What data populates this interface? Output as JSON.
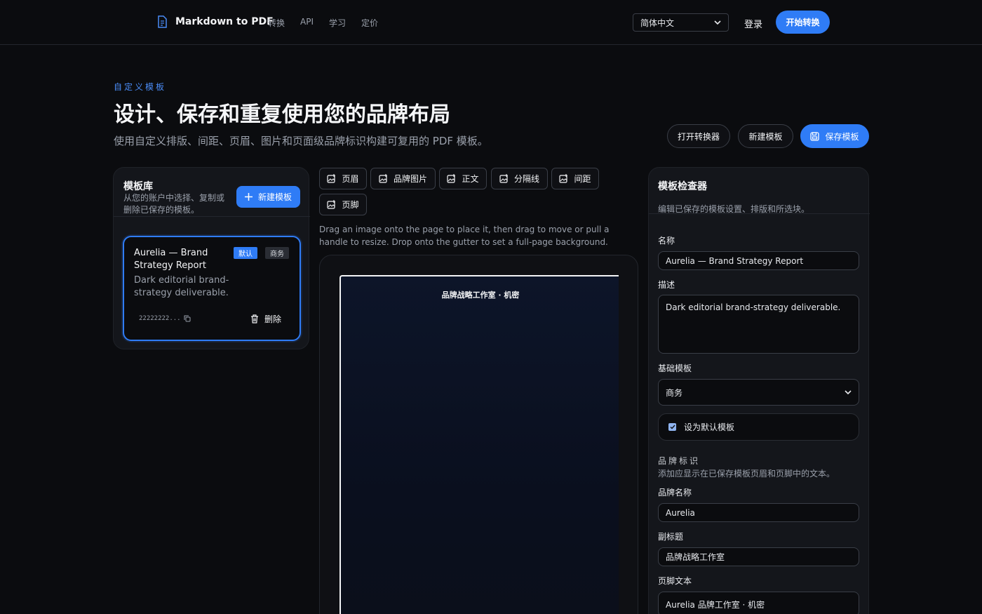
{
  "nav": {
    "brand": "Markdown to PDF",
    "links": [
      "转换",
      "API",
      "学习",
      "定价"
    ],
    "language": "简体中文",
    "login": "登录",
    "start": "开始转换"
  },
  "hero": {
    "eyebrow": "自定义模板",
    "title": "设计、保存和重复使用您的品牌布局",
    "subtitle": "使用自定义排版、间距、页眉、图片和页面级品牌标识构建可复用的 PDF 模板。",
    "open_converter": "打开转换器",
    "new_template": "新建模板",
    "save_template": "保存模板"
  },
  "library": {
    "title": "模板库",
    "description": "从您的账户中选择、复制或删除已保存的模板。",
    "new_button": "新建模板",
    "card": {
      "name": "Aurelia — Brand Strategy Report",
      "badge_default": "默认",
      "badge_type": "商务",
      "description": "Dark editorial brand-strategy deliverable.",
      "id": "22222222...",
      "delete": "删除"
    }
  },
  "toolbar": {
    "buttons": [
      "页眉",
      "品牌图片",
      "正文",
      "分隔线",
      "间距",
      "页脚"
    ],
    "hint": "Drag an image onto the page to place it, then drag to move or pull a handle to resize. Drop onto the gutter to set a full-page background."
  },
  "canvas": {
    "header_text": "品牌战略工作室  ·  机密"
  },
  "inspector": {
    "title": "模板检查器",
    "description": "编辑已保存的模板设置、排版和所选块。",
    "name_label": "名称",
    "name_value": "Aurelia — Brand Strategy Report",
    "desc_label": "描述",
    "desc_value": "Dark editorial brand-strategy deliverable.",
    "base_label": "基础模板",
    "base_value": "商务",
    "default_check": "设为默认模板",
    "brand_section_title": "品牌标识",
    "brand_section_desc": "添加应显示在已保存模板页眉和页脚中的文本。",
    "brand_name_label": "品牌名称",
    "brand_name_value": "Aurelia",
    "subtitle_label": "副标题",
    "subtitle_value": "品牌战略工作室",
    "footer_label": "页脚文本",
    "footer_value": "Aurelia 品牌工作室  ·  机密"
  },
  "colors": {
    "accent": "#2f7cf6",
    "background": "#0b0c0f",
    "panel": "#14161b"
  }
}
